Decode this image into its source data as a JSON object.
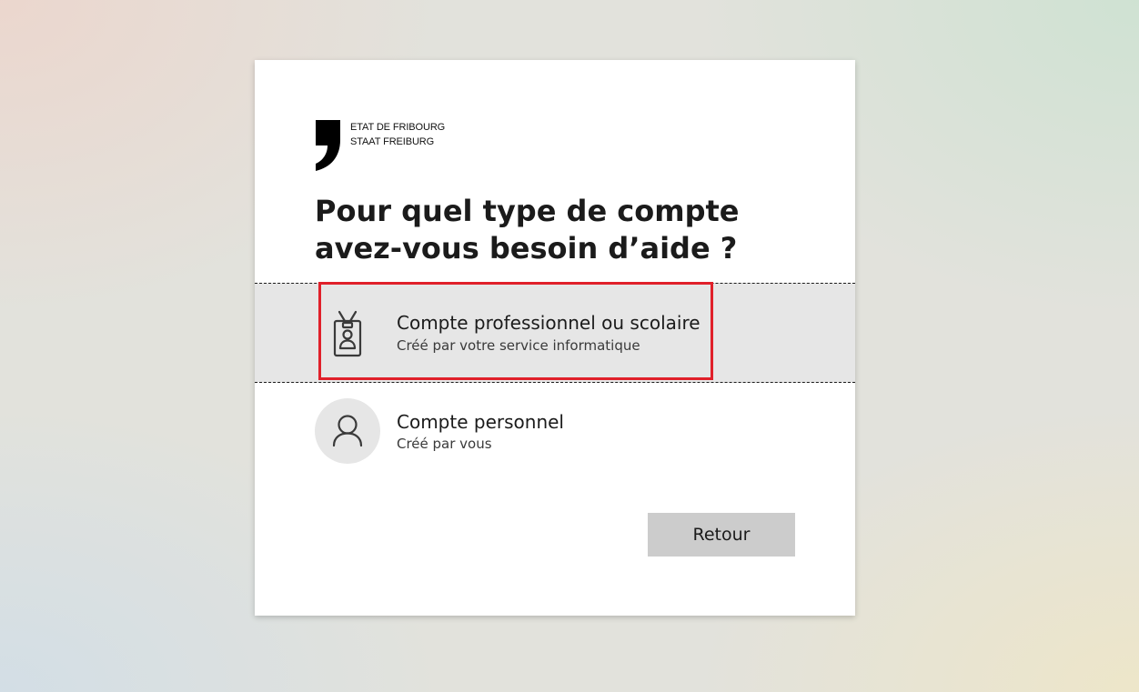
{
  "logo": {
    "line1": "ETAT DE FRIBOURG",
    "line2": "STAAT FREIBURG",
    "icon": "comma-logo-icon"
  },
  "title": "Pour quel type de compte avez-vous besoin d’aide ?",
  "options": [
    {
      "title": "Compte professionnel ou scolaire",
      "subtitle": "Créé par votre service informatique",
      "icon": "id-badge-icon",
      "highlighted": true
    },
    {
      "title": "Compte personnel",
      "subtitle": "Créé par vous",
      "icon": "person-icon",
      "highlighted": false
    }
  ],
  "buttons": {
    "back_label": "Retour"
  },
  "colors": {
    "highlight_border": "#e0202a",
    "selected_row_bg": "#e6e6e6",
    "button_bg": "#cccccc"
  }
}
